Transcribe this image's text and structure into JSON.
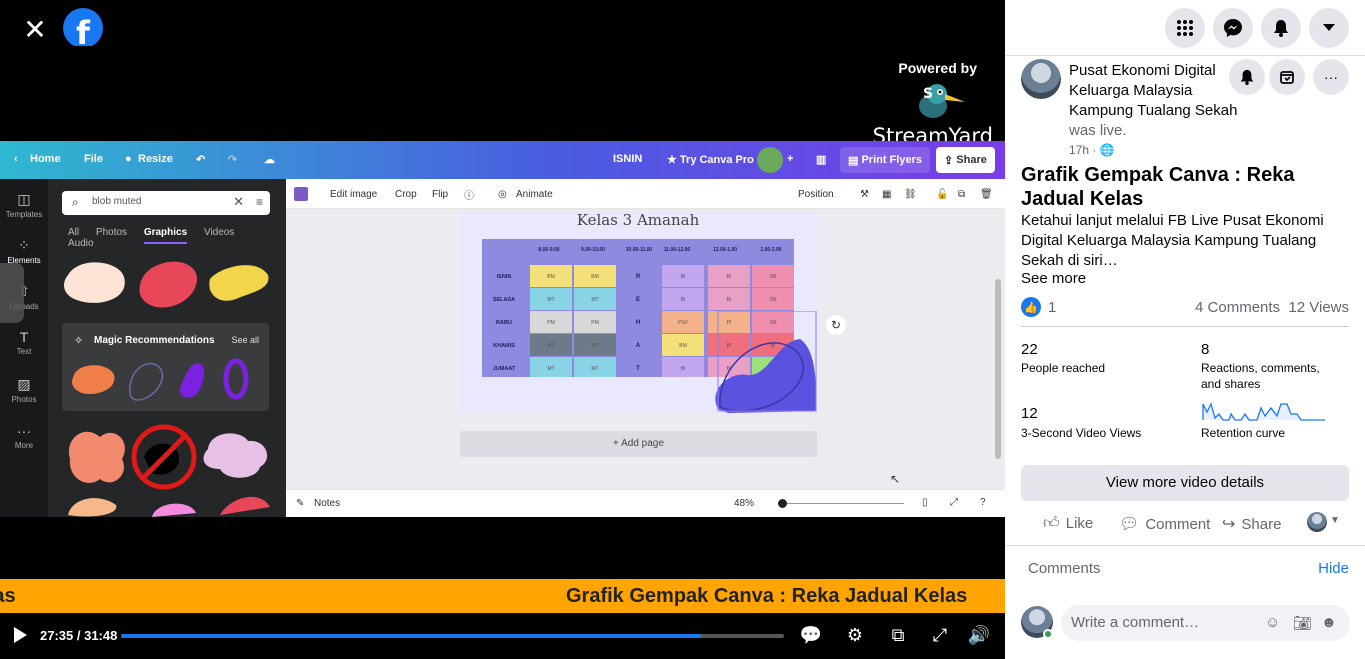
{
  "player": {
    "close_icon": "close-icon",
    "fb_logo": "facebook-logo",
    "overlay_powered": "Powered by",
    "overlay_brand": "StreamYard",
    "ticker_left": "al Kelas",
    "ticker_main": "Grafik Gempak Canva : Reka Jadual Kelas",
    "time": "27:35 / 31:48",
    "progress_fraction": 0.875,
    "progress_color": "#1877f2",
    "ticker_color": "#ffa400"
  },
  "canva": {
    "top": {
      "home": "Home",
      "file": "File",
      "resize": "Resize",
      "doc_title": "ISNIN",
      "try_pro": "Try Canva Pro",
      "print": "Print Flyers",
      "share": "Share"
    },
    "side": {
      "templates": "Templates",
      "elements": "Elements",
      "uploads": "Uploads",
      "text": "Text",
      "photos": "Photos",
      "more": "More"
    },
    "search_value": "blob muted",
    "tabs": [
      "All",
      "Photos",
      "Graphics",
      "Videos",
      "Audio"
    ],
    "active_tab": "Graphics",
    "magic_title": "Magic Recommendations",
    "magic_see_all": "See all",
    "toolbar": {
      "edit_image": "Edit image",
      "crop": "Crop",
      "flip": "Flip",
      "animate": "Animate",
      "position": "Position"
    },
    "page_title": "Kelas 3 Amanah",
    "timetable": {
      "times": [
        "8.00-9.00",
        "9.00-10.00",
        "10.00-11.00",
        "11.00-12.00",
        "12.00-1.00",
        "1.00-2.00"
      ],
      "days": [
        "ISNIN",
        "SELASA",
        "RABU",
        "KHAMIS",
        "JUMAAT"
      ],
      "break_letters": [
        "R",
        "E",
        "H",
        "A",
        "T"
      ],
      "rows": [
        [
          "BM",
          "BM",
          "BI",
          "BI",
          "SN"
        ],
        [
          "MT",
          "MT",
          "BI",
          "BI",
          "SN"
        ],
        [
          "PM",
          "PM",
          "PSV",
          "PI",
          "SN"
        ],
        [
          "MT",
          "MT",
          "BM",
          "BI",
          "BI"
        ],
        [
          "MT",
          "MT",
          "BI",
          "BI",
          "SN"
        ]
      ]
    },
    "add_page": "+ Add page",
    "notes": "Notes",
    "zoom": "48%"
  },
  "sidebar": {
    "page_name": "Pusat Ekonomi Digital Keluarga Malaysia Kampung Tualang Sekah",
    "was_live": "was live.",
    "time_ago": "17h",
    "title": "Grafik Gempak Canva : Reka Jadual Kelas",
    "description": "Ketahui lanjut melalui FB Live Pusat Ekonomi Digital Keluarga Malaysia Kampung Tualang Sekah di siri…",
    "see_more": "See more",
    "reactions": "1",
    "comments_count": "4 Comments",
    "views_count": "12 Views",
    "stats": [
      {
        "value": "22",
        "label": "People reached"
      },
      {
        "value": "8",
        "label": "Reactions, comments, and shares"
      },
      {
        "value": "12",
        "label": "3-Second Video Views"
      },
      {
        "value": "",
        "label": "Retention curve"
      }
    ],
    "view_more": "View more video details",
    "like": "Like",
    "comment": "Comment",
    "share": "Share",
    "comments_label": "Comments",
    "hide": "Hide",
    "comment_placeholder": "Write a comment…"
  }
}
